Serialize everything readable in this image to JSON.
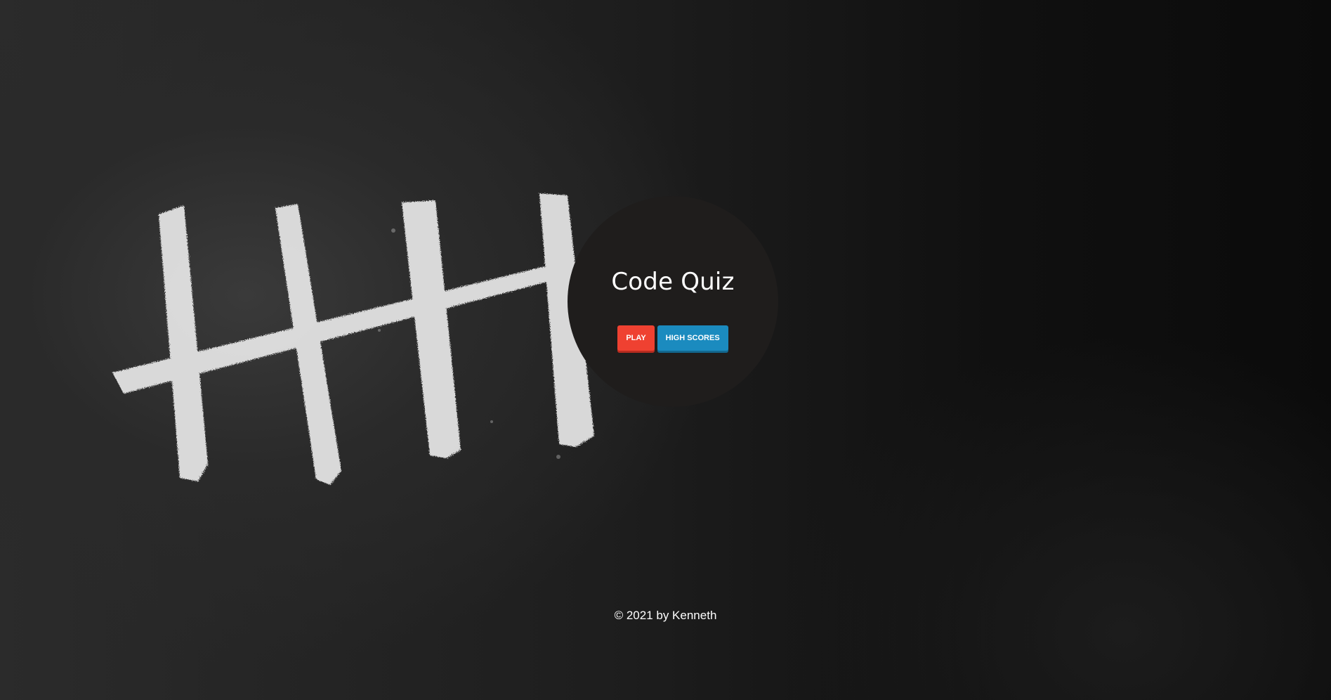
{
  "app": {
    "title": "Code Quiz",
    "background_image": "chalk-tally-marks-on-blackboard"
  },
  "buttons": {
    "play_label": "PLAY",
    "high_scores_label": "HIGH SCORES"
  },
  "footer": {
    "text": "© 2021 by Kenneth"
  },
  "colors": {
    "play_button": "#ef4131",
    "high_scores_button": "#1b8bbf",
    "circle": "#1f1d1c",
    "text": "#ffffff"
  }
}
